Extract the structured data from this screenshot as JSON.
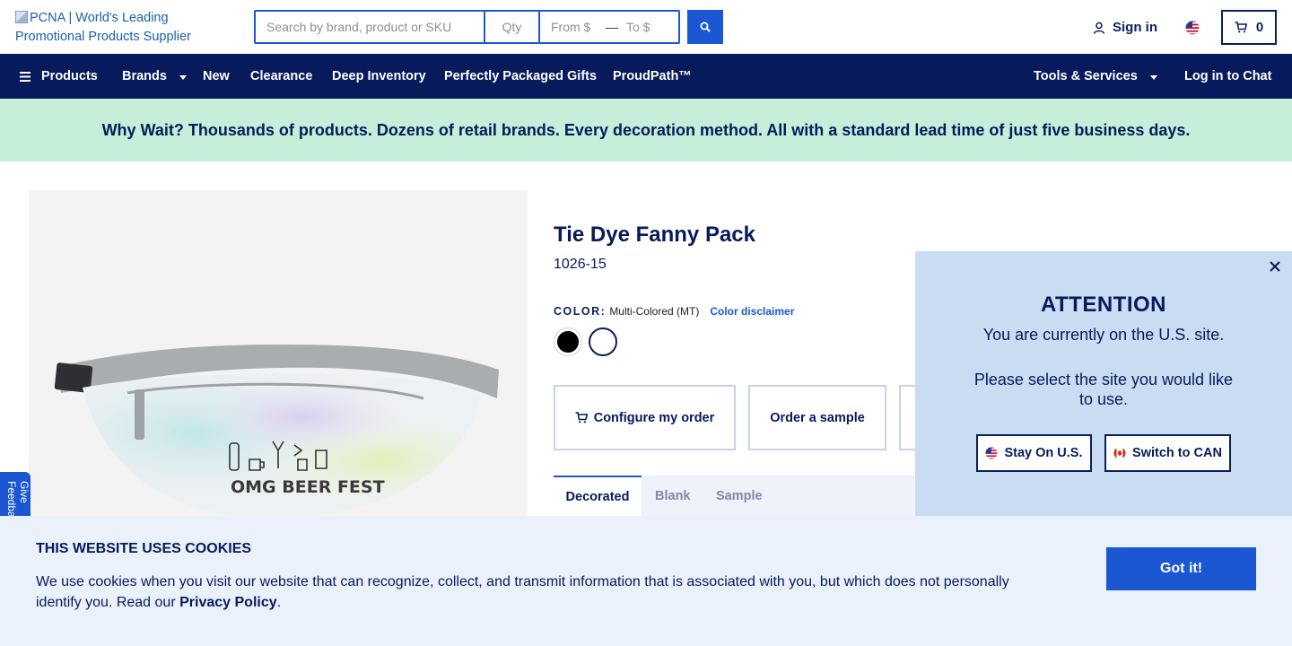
{
  "header": {
    "logo_alt": "PCNA | World's Leading Promotional Products Supplier",
    "search": {
      "placeholder": "Search by brand, product or SKU",
      "qty_placeholder": "Qty",
      "from_placeholder": "From $",
      "range_separator": "—",
      "to_placeholder": "To $"
    },
    "sign_in_label": "Sign in",
    "cart_count": "0"
  },
  "nav": {
    "products_label": "Products",
    "items": [
      "Brands",
      "New",
      "Clearance",
      "Deep Inventory",
      "Perfectly Packaged Gifts",
      "ProudPath™"
    ],
    "tools_label": "Tools & Services",
    "chat_label": "Log in to Chat"
  },
  "promo": {
    "text": "Why Wait? Thousands of products. Dozens of retail brands. Every decoration method. All with a standard lead time of just five business days."
  },
  "product": {
    "title": "Tie Dye Fanny Pack",
    "sku": "1026-15",
    "color_label": "COLOR:",
    "color_value": "Multi-Colored (MT)",
    "color_disclaimer": "Color disclaimer",
    "swatches": [
      {
        "name": "Black",
        "hex": "#000000"
      },
      {
        "name": "Multi-Colored (MT)",
        "hex": "#ffffff"
      }
    ],
    "actions": {
      "configure": "Configure my order",
      "sample": "Order a sample"
    },
    "tabs": [
      "Decorated",
      "Blank",
      "Sample"
    ],
    "imprint_text": "OMG BEER FEST"
  },
  "feedback": {
    "label": "Give Feedback"
  },
  "region_dialog": {
    "title": "ATTENTION",
    "line1": "You are currently on the U.S. site.",
    "line2": "Please select the site you would like to use.",
    "stay_label": "Stay On U.S.",
    "switch_label": "Switch to CAN"
  },
  "cookie": {
    "title": "THIS WEBSITE USES COOKIES",
    "text_before": "We use cookies when you visit our website that can recognize, collect, and transmit information that is associated with you, but which does not personally identify you. Read our",
    "link_label": "Privacy Policy",
    "text_after": ".",
    "button_label": "Got it!"
  },
  "colors": {
    "navy": "#071a5c",
    "blue": "#1b57d3",
    "promo_bg": "#c5efd8",
    "dialog_bg": "#c9dcf1",
    "cookie_bg": "#eaf1fb"
  }
}
